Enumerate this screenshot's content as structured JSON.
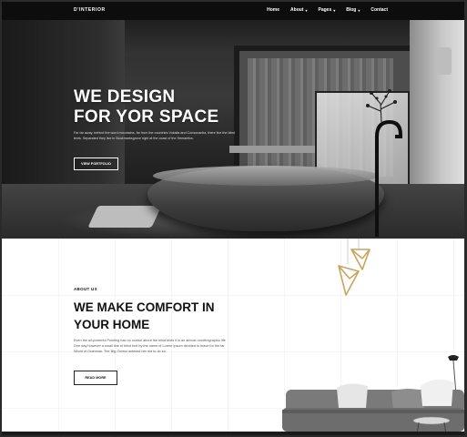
{
  "brand": {
    "logo": "D'INTERIOR"
  },
  "nav": {
    "items": [
      {
        "label": "Home",
        "dropdown": false
      },
      {
        "label": "About",
        "dropdown": true
      },
      {
        "label": "Pages",
        "dropdown": true
      },
      {
        "label": "Blog",
        "dropdown": true
      },
      {
        "label": "Contact",
        "dropdown": false
      }
    ]
  },
  "hero": {
    "title_line1": "WE DESIGN",
    "title_line2": "FOR YOR SPACE",
    "text": "Far far away, behind the word mountains, far from the countries Vokalia and Consonantia, there live the blind texts. Separated they live in Bookmarksgrove right at the coast of the Semantics.",
    "button_label": "VIEW PORTFOLIO"
  },
  "about": {
    "eyebrow": "ABOUT US",
    "title_line1": "WE MAKE COMFORT IN",
    "title_line2": "YOUR HOME",
    "text": "Even the all-powerful Pointing has no control about the blind texts it is an almost unorthographic life One day however a small line of blind text by the name of Lorem Ipsum decided to leave for the far World of Grammar. The Big Oxmox advised her not to do so.",
    "button_label": "READ MORE"
  },
  "colors": {
    "nav_bg": "#0d0d0d",
    "text_dark": "#111111",
    "lamp_gold": "#c9a45c",
    "sofa_grey": "#6d6d6d"
  },
  "icons": [
    "chevron-down-icon"
  ]
}
